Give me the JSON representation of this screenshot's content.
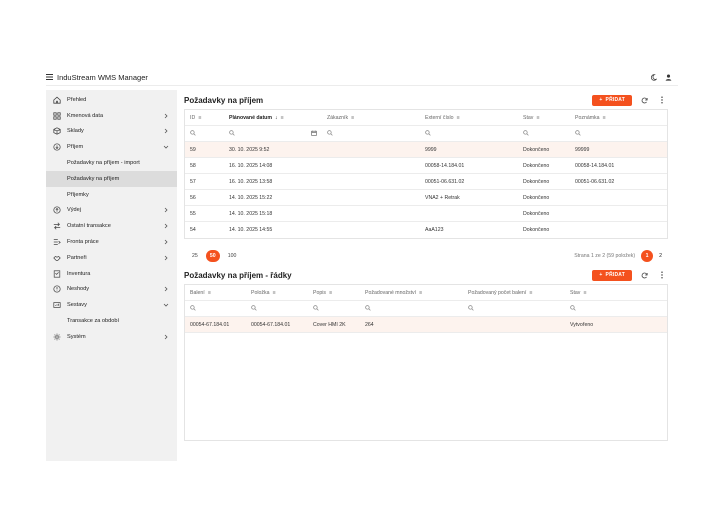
{
  "app": {
    "title": "InduStream WMS Manager"
  },
  "sidebar": {
    "items": [
      {
        "label": "Přehled",
        "icon": "dashboard-icon",
        "chevron": ""
      },
      {
        "label": "Kmenová data",
        "icon": "database-icon",
        "chevron": "right"
      },
      {
        "label": "Sklady",
        "icon": "warehouse-icon",
        "chevron": "right"
      },
      {
        "label": "Příjem",
        "icon": "inbound-icon",
        "chevron": "down"
      },
      {
        "label": "Požadavky na příjem - import",
        "sub": true
      },
      {
        "label": "Požadavky na příjem",
        "sub": true,
        "active": true
      },
      {
        "label": "Příjemky",
        "sub": true
      },
      {
        "label": "Výdej",
        "icon": "outbound-icon",
        "chevron": "right"
      },
      {
        "label": "Ostatní transakce",
        "icon": "transfer-icon",
        "chevron": "right"
      },
      {
        "label": "Fronta práce",
        "icon": "queue-icon",
        "chevron": "right"
      },
      {
        "label": "Partneři",
        "icon": "handshake-icon",
        "chevron": "right"
      },
      {
        "label": "Inventura",
        "icon": "inventory-icon",
        "chevron": ""
      },
      {
        "label": "Neshody",
        "icon": "alert-icon",
        "chevron": "right"
      },
      {
        "label": "Sestavy",
        "icon": "report-icon",
        "chevron": "down"
      },
      {
        "label": "Transakce za období",
        "sub": true
      },
      {
        "label": "Systém",
        "icon": "gear-icon",
        "chevron": "right"
      }
    ]
  },
  "requests": {
    "title": "Požadavky na příjem",
    "add_label": "PŘIDAT",
    "columns": [
      "ID",
      "Plánované datum",
      "Zákazník",
      "Externí číslo",
      "Stav",
      "Poznámka"
    ],
    "rows": [
      [
        "59",
        "30. 10. 2025 9:52",
        "",
        "9999",
        "Dokončeno",
        "99999"
      ],
      [
        "58",
        "16. 10. 2025 14:08",
        "",
        "00058-14.184.01",
        "Dokončeno",
        "00058-14.184.01"
      ],
      [
        "57",
        "16. 10. 2025 13:58",
        "",
        "00051-06.631.02",
        "Dokončeno",
        "00051-06.631.02"
      ],
      [
        "56",
        "14. 10. 2025 15:22",
        "",
        "VNA2 + Retrak",
        "Dokončeno",
        ""
      ],
      [
        "55",
        "14. 10. 2025 15:18",
        "",
        "",
        "Dokončeno",
        ""
      ],
      [
        "54",
        "14. 10. 2025 14:55",
        "",
        "AaA123",
        "Dokončeno",
        ""
      ]
    ],
    "page_sizes": [
      "25",
      "50",
      "100"
    ],
    "page_size_selected": "50",
    "page_info": "Strana 1 ze 2 (59 položek)",
    "pages": [
      "1",
      "2"
    ]
  },
  "lines": {
    "title": "Požadavky na příjem - řádky",
    "add_label": "PŘIDAT",
    "columns": [
      "Balení",
      "Položka",
      "Popis",
      "Požadované množství",
      "Požadovaný počet balení",
      "Stav"
    ],
    "rows": [
      [
        "00054-67.184.01",
        "00054-67.184.01",
        "Cover HMI 2K",
        "264",
        "",
        "Vytvořeno"
      ]
    ]
  },
  "colors": {
    "accent": "#f4511e",
    "sidebar_bg": "#f1f1f1",
    "highlight_row": "#fdf3ee"
  }
}
